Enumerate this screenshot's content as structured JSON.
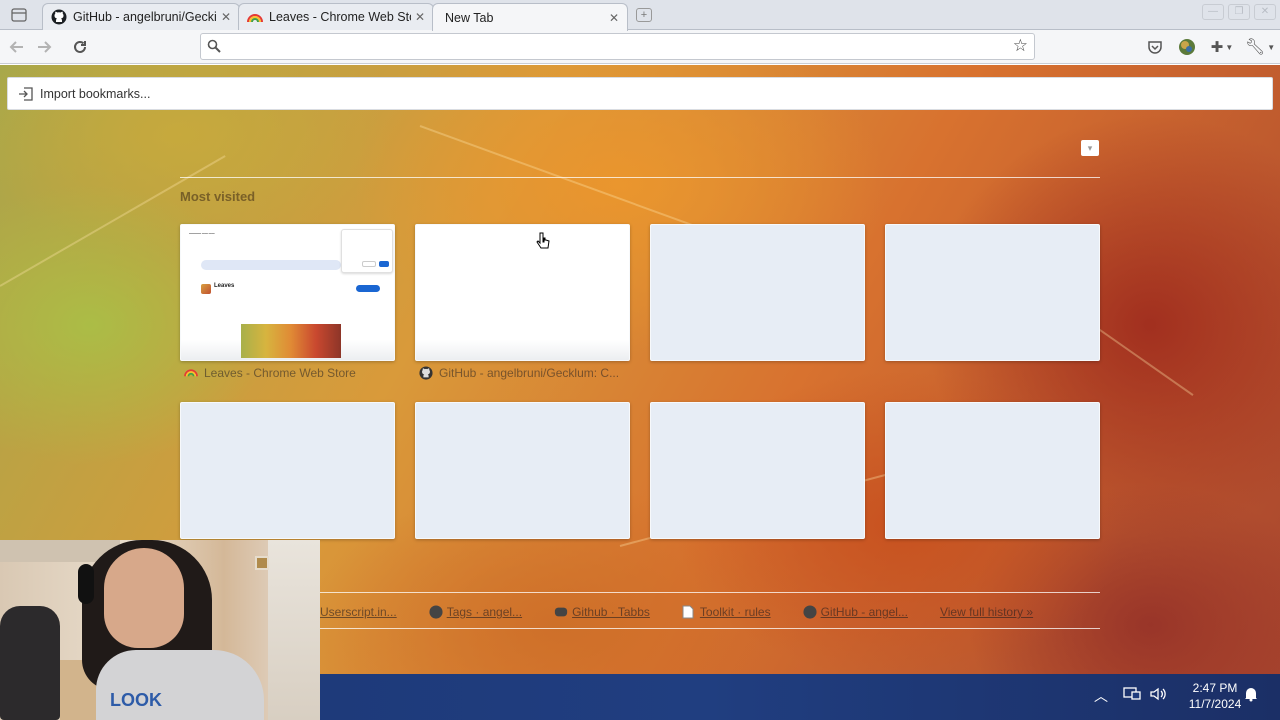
{
  "tabs": [
    {
      "title": "GitHub - angelbruni/Geckiu",
      "favicon": "github-icon",
      "active": false
    },
    {
      "title": "Leaves - Chrome Web Store",
      "favicon": "rainbow-icon",
      "active": false
    },
    {
      "title": "New Tab",
      "favicon": "",
      "active": true
    }
  ],
  "omnibox": {
    "value": "",
    "placeholder": ""
  },
  "bookmarks": {
    "import_label": "Import bookmarks..."
  },
  "most_visited": {
    "title": "Most visited",
    "tiles": [
      {
        "caption": "Leaves - Chrome Web Store",
        "icon": "rainbow-icon",
        "thumb_name": "Leaves"
      },
      {
        "caption": "GitHub - angelbruni/Gecklum: C...",
        "icon": "github-icon"
      },
      {
        "caption": ""
      },
      {
        "caption": ""
      },
      {
        "caption": ""
      },
      {
        "caption": ""
      },
      {
        "caption": ""
      },
      {
        "caption": ""
      }
    ]
  },
  "recently_closed": {
    "items": [
      {
        "label": "Userscript.in...",
        "icon": ""
      },
      {
        "label": "Tags · angel...",
        "icon": "github-icon"
      },
      {
        "label": "Github · Tabbs",
        "icon": "discord-icon"
      },
      {
        "label": "Toolkit · rules",
        "icon": "page-icon"
      },
      {
        "label": "GitHub - angel...",
        "icon": "github-icon"
      }
    ],
    "view_history": "View full history »"
  },
  "taskbar": {
    "time": "2:47 PM",
    "date": "11/7/2024"
  },
  "webcam": {
    "shirt_text": "LOOK"
  },
  "colors": {
    "taskbar": "#1f3c7d",
    "tile": "#e7edf5",
    "accent": "#1a66d2"
  }
}
